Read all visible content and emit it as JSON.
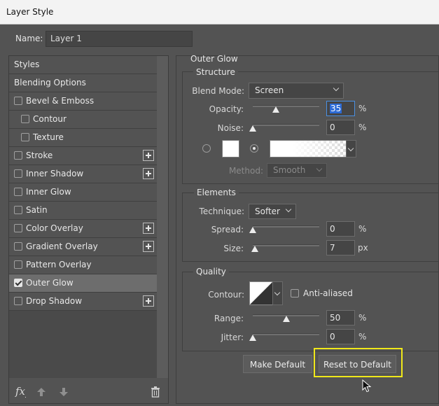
{
  "window": {
    "title": "Layer Style"
  },
  "name_field": {
    "label": "Name:",
    "value": "Layer 1"
  },
  "styles_list": [
    {
      "label": "Styles",
      "has_checkbox": false,
      "checked": false,
      "indent": false,
      "has_add": false,
      "selected": false
    },
    {
      "label": "Blending Options",
      "has_checkbox": false,
      "checked": false,
      "indent": false,
      "has_add": false,
      "selected": false
    },
    {
      "label": "Bevel & Emboss",
      "has_checkbox": true,
      "checked": false,
      "indent": false,
      "has_add": false,
      "selected": false
    },
    {
      "label": "Contour",
      "has_checkbox": true,
      "checked": false,
      "indent": true,
      "has_add": false,
      "selected": false
    },
    {
      "label": "Texture",
      "has_checkbox": true,
      "checked": false,
      "indent": true,
      "has_add": false,
      "selected": false
    },
    {
      "label": "Stroke",
      "has_checkbox": true,
      "checked": false,
      "indent": false,
      "has_add": true,
      "selected": false
    },
    {
      "label": "Inner Shadow",
      "has_checkbox": true,
      "checked": false,
      "indent": false,
      "has_add": true,
      "selected": false
    },
    {
      "label": "Inner Glow",
      "has_checkbox": true,
      "checked": false,
      "indent": false,
      "has_add": false,
      "selected": false
    },
    {
      "label": "Satin",
      "has_checkbox": true,
      "checked": false,
      "indent": false,
      "has_add": false,
      "selected": false
    },
    {
      "label": "Color Overlay",
      "has_checkbox": true,
      "checked": false,
      "indent": false,
      "has_add": true,
      "selected": false
    },
    {
      "label": "Gradient Overlay",
      "has_checkbox": true,
      "checked": false,
      "indent": false,
      "has_add": true,
      "selected": false
    },
    {
      "label": "Pattern Overlay",
      "has_checkbox": true,
      "checked": false,
      "indent": false,
      "has_add": false,
      "selected": false
    },
    {
      "label": "Outer Glow",
      "has_checkbox": true,
      "checked": true,
      "indent": false,
      "has_add": false,
      "selected": true
    },
    {
      "label": "Drop Shadow",
      "has_checkbox": true,
      "checked": false,
      "indent": false,
      "has_add": true,
      "selected": false
    }
  ],
  "footer_icons": [
    "fx-icon",
    "move-up-icon",
    "move-down-icon",
    "trash-icon"
  ],
  "panel": {
    "title": "Outer Glow",
    "structure": {
      "title": "Structure",
      "blend_mode_label": "Blend Mode:",
      "blend_mode_value": "Screen",
      "opacity_label": "Opacity:",
      "opacity_value": "35",
      "opacity_slider": 0.35,
      "noise_label": "Noise:",
      "noise_value": "0",
      "noise_slider": 0.0,
      "percent": "%",
      "method_label": "Method:",
      "method_value": "Smooth"
    },
    "elements": {
      "title": "Elements",
      "technique_label": "Technique:",
      "technique_value": "Softer",
      "spread_label": "Spread:",
      "spread_value": "0",
      "spread_slider": 0.0,
      "size_label": "Size:",
      "size_value": "7",
      "size_slider": 0.028,
      "px": "px",
      "percent": "%"
    },
    "quality": {
      "title": "Quality",
      "contour_label": "Contour:",
      "anti_aliased_label": "Anti-aliased",
      "anti_aliased_checked": false,
      "range_label": "Range:",
      "range_value": "50",
      "range_slider": 0.5,
      "jitter_label": "Jitter:",
      "jitter_value": "0",
      "jitter_slider": 0.0,
      "percent": "%"
    },
    "buttons": {
      "make_default": "Make Default",
      "reset_default": "Reset to Default"
    }
  },
  "colors": {
    "highlight": "#f0e81a",
    "focus": "#4a90e2"
  }
}
